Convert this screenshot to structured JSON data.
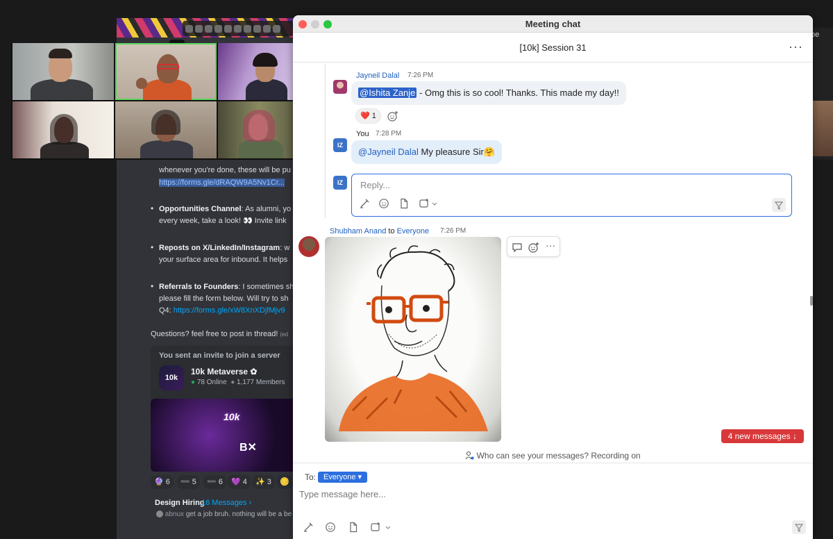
{
  "shared_screen": {
    "lines": [
      {
        "text": "whenever you're done, these will be pu"
      },
      {
        "link": "https://forms.gle/dRAQW9A5Nv1Cr..."
      },
      {
        "bold": "Opportunities Channel",
        "text": ": As alumni, yo"
      },
      {
        "text": "every week, take a look! 👀 Invite link"
      },
      {
        "bold": "Reposts on X/LinkedIn/Instagram",
        "text": ": w"
      },
      {
        "text": "your surface area for inbound. It helps"
      },
      {
        "bold": "Referrals to Founders",
        "text": ": I sometimes sh"
      },
      {
        "text": "please fill the form below. Will try to sh"
      },
      {
        "text": "Q4: ",
        "link": "https://forms.gle/xW8XnXDjfMjv9"
      },
      {
        "text": "Questions? feel free to post in thread!",
        "suffix": "(ed"
      }
    ],
    "invite": {
      "heading": "You sent an invite to join a server",
      "server_icon": "10k",
      "server_name": "10k Metaverse",
      "online": "78 Online",
      "members": "1,177 Members"
    },
    "reactions": [
      "6",
      "5",
      "6",
      "4",
      "3"
    ],
    "thread": {
      "title": "Design Hiring",
      "count": "16 Messages ›",
      "preview_user": "abnux",
      "preview_text": "get a job bruh. nothing will be a be"
    }
  },
  "right_peek_label": "oe",
  "chat": {
    "window_title": "Meeting chat",
    "chat_name": "[10k] Session 31",
    "more_icon": "···",
    "messages": [
      {
        "sender": "Jayneil Dalal",
        "time": "7:26 PM",
        "mention": "@Ishita Zanje",
        "text": " - Omg this is so cool! Thanks. This  made my day!!",
        "reaction_emoji": "❤️",
        "reaction_count": "1"
      },
      {
        "sender": "You",
        "avatar": "IZ",
        "time": "7:28 PM",
        "mention": "@Jayneil Dalal",
        "text": " My pleasure Sir🤗"
      },
      {
        "sender": "Shubham Anand",
        "to_label": "to",
        "recipient": "Everyone",
        "time": "7:26 PM",
        "attachment": "caricature-sketch"
      }
    ],
    "reply_avatar": "IZ",
    "reply_placeholder": "Reply...",
    "new_messages_label": "4 new messages ↓",
    "privacy_notice": "Who can see your messages? Recording on",
    "composer": {
      "to_label": "To:",
      "recipient": "Everyone",
      "placeholder": "Type message here..."
    }
  },
  "colors": {
    "accent": "#2c6fde",
    "mention": "#1f5fbf",
    "new_messages_bg": "#d9383a",
    "active_speaker": "#5ad35a"
  },
  "icons": [
    "format-icon",
    "emoji-icon",
    "file-icon",
    "screenshot-icon",
    "send-icon",
    "add-reaction-icon",
    "reply-thread-icon",
    "more-icon"
  ]
}
